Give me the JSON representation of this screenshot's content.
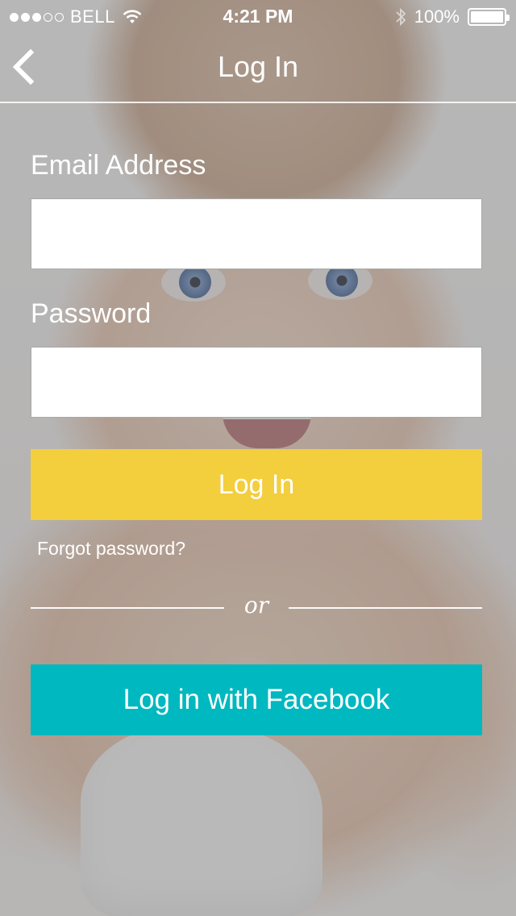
{
  "status_bar": {
    "carrier": "BELL",
    "time": "4:21 PM",
    "battery": "100%",
    "signal_bars": 3,
    "signal_total": 5,
    "battery_level": 1.0
  },
  "nav": {
    "title": "Log In",
    "back_icon": "chevron-left-icon"
  },
  "form": {
    "email_label": "Email Address",
    "email_value": "",
    "password_label": "Password",
    "password_value": "",
    "login_button": "Log In",
    "forgot_link": "Forgot password?",
    "divider_text": "or",
    "facebook_button": "Log in with Facebook"
  },
  "colors": {
    "login_button": "#f3ce3d",
    "facebook_button": "#00b8bf",
    "text": "#ffffff"
  }
}
